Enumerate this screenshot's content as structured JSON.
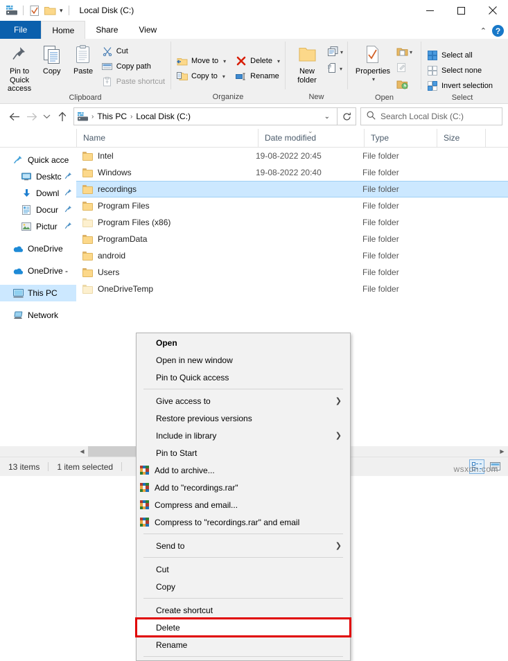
{
  "window": {
    "title": "Local Disk (C:)",
    "controls": {
      "minimize": "minimize-icon",
      "maximize": "maximize-icon",
      "close": "close-icon"
    }
  },
  "quick_access_toolbar": {
    "items": [
      "explorer-icon",
      "properties-icon",
      "new-folder-icon",
      "customize-caret"
    ]
  },
  "tabs": [
    {
      "label": "File",
      "id": "file"
    },
    {
      "label": "Home",
      "id": "home"
    },
    {
      "label": "Share",
      "id": "share"
    },
    {
      "label": "View",
      "id": "view"
    }
  ],
  "ribbon": {
    "groups": [
      {
        "label": "Clipboard",
        "big_buttons": [
          {
            "label": "Pin to Quick access",
            "icon": "pin-icon"
          },
          {
            "label": "Copy",
            "icon": "copy-icon"
          },
          {
            "label": "Paste",
            "icon": "paste-icon"
          }
        ],
        "small_buttons": [
          {
            "label": "Cut",
            "icon": "scissors-icon",
            "disabled": false
          },
          {
            "label": "Copy path",
            "icon": "copy-path-icon",
            "disabled": false
          },
          {
            "label": "Paste shortcut",
            "icon": "paste-shortcut-icon",
            "disabled": true
          }
        ]
      },
      {
        "label": "Organize",
        "small_buttons": [
          {
            "label": "Move to",
            "icon": "move-to-icon",
            "caret": true
          },
          {
            "label": "Copy to",
            "icon": "copy-to-icon",
            "caret": true
          },
          {
            "label": "Delete",
            "icon": "delete-x-icon",
            "caret": true
          },
          {
            "label": "Rename",
            "icon": "rename-icon",
            "caret": false
          }
        ]
      },
      {
        "label": "New",
        "big_buttons": [
          {
            "label": "New folder",
            "icon": "new-folder-icon"
          }
        ],
        "gallery": [
          "new-item-icon",
          "easy-access-icon"
        ]
      },
      {
        "label": "Open",
        "big_buttons": [
          {
            "label": "Properties",
            "icon": "properties-icon",
            "caret": true
          }
        ],
        "gallery": [
          "open-icon",
          "edit-icon",
          "history-icon"
        ]
      },
      {
        "label": "Select",
        "small_buttons": [
          {
            "label": "Select all",
            "icon": "select-all-icon"
          },
          {
            "label": "Select none",
            "icon": "select-none-icon"
          },
          {
            "label": "Invert selection",
            "icon": "invert-selection-icon"
          }
        ]
      }
    ]
  },
  "navigation": {
    "back": "back-arrow-icon",
    "forward": "forward-arrow-icon",
    "recent": "recent-locations-caret",
    "up": "up-arrow-icon",
    "breadcrumb": [
      "This PC",
      "Local Disk (C:)"
    ],
    "refresh": "refresh-icon",
    "search_placeholder": "Search Local Disk (C:)"
  },
  "columns": [
    {
      "label": "Name",
      "sorted": false
    },
    {
      "label": "Date modified",
      "sorted": true
    },
    {
      "label": "Type",
      "sorted": false
    },
    {
      "label": "Size",
      "sorted": false
    }
  ],
  "sidebar": {
    "items": [
      {
        "label": "Quick acce",
        "icon": "quick-access-star-icon",
        "indent": false,
        "pinned": false,
        "selected": false
      },
      {
        "label": "Desktc",
        "icon": "desktop-icon",
        "indent": true,
        "pinned": true,
        "selected": false
      },
      {
        "label": "Downl",
        "icon": "downloads-icon",
        "indent": true,
        "pinned": true,
        "selected": false
      },
      {
        "label": "Docur",
        "icon": "documents-icon",
        "indent": true,
        "pinned": true,
        "selected": false
      },
      {
        "label": "Pictur",
        "icon": "pictures-icon",
        "indent": true,
        "pinned": true,
        "selected": false
      },
      {
        "label": "OneDrive",
        "icon": "onedrive-icon",
        "indent": false,
        "pinned": false,
        "selected": false,
        "gap_before": true
      },
      {
        "label": "OneDrive -",
        "icon": "onedrive-icon",
        "indent": false,
        "pinned": false,
        "selected": false,
        "gap_before": true
      },
      {
        "label": "This PC",
        "icon": "this-pc-icon",
        "indent": false,
        "pinned": false,
        "selected": true,
        "gap_before": true
      },
      {
        "label": "Network",
        "icon": "network-icon",
        "indent": false,
        "pinned": false,
        "selected": false,
        "gap_before": true
      }
    ]
  },
  "files": [
    {
      "name": "Intel",
      "date": "19-08-2022 20:45",
      "type": "File folder",
      "size": "",
      "selected": false,
      "pale": false
    },
    {
      "name": "Windows",
      "date": "19-08-2022 20:40",
      "type": "File folder",
      "size": "",
      "selected": false,
      "pale": false
    },
    {
      "name": "recordings",
      "date": "",
      "type": "File folder",
      "size": "",
      "selected": true,
      "pale": false
    },
    {
      "name": "Program Files",
      "date": "",
      "type": "File folder",
      "size": "",
      "selected": false,
      "pale": false
    },
    {
      "name": "Program Files (x86)",
      "date": "",
      "type": "File folder",
      "size": "",
      "selected": false,
      "pale": true
    },
    {
      "name": "ProgramData",
      "date": "",
      "type": "File folder",
      "size": "",
      "selected": false,
      "pale": false
    },
    {
      "name": "android",
      "date": "",
      "type": "File folder",
      "size": "",
      "selected": false,
      "pale": false
    },
    {
      "name": "Users",
      "date": "",
      "type": "File folder",
      "size": "",
      "selected": false,
      "pale": false
    },
    {
      "name": "OneDriveTemp",
      "date": "",
      "type": "File folder",
      "size": "",
      "selected": false,
      "pale": true
    }
  ],
  "context_menu": {
    "items": [
      {
        "label": "Open",
        "bold": true,
        "icon": "",
        "arrow": false
      },
      {
        "label": "Open in new window",
        "bold": false,
        "icon": "",
        "arrow": false
      },
      {
        "label": "Pin to Quick access",
        "bold": false,
        "icon": "",
        "arrow": false
      },
      {
        "divider": true
      },
      {
        "label": "Give access to",
        "bold": false,
        "icon": "",
        "arrow": true
      },
      {
        "label": "Restore previous versions",
        "bold": false,
        "icon": "",
        "arrow": false
      },
      {
        "label": "Include in library",
        "bold": false,
        "icon": "",
        "arrow": true
      },
      {
        "label": "Pin to Start",
        "bold": false,
        "icon": "",
        "arrow": false
      },
      {
        "label": "Add to archive...",
        "bold": false,
        "icon": "winrar-icon",
        "arrow": false
      },
      {
        "label": "Add to \"recordings.rar\"",
        "bold": false,
        "icon": "winrar-icon",
        "arrow": false
      },
      {
        "label": "Compress and email...",
        "bold": false,
        "icon": "winrar-icon",
        "arrow": false
      },
      {
        "label": "Compress to \"recordings.rar\" and email",
        "bold": false,
        "icon": "winrar-icon",
        "arrow": false
      },
      {
        "divider": true
      },
      {
        "label": "Send to",
        "bold": false,
        "icon": "",
        "arrow": true
      },
      {
        "divider": true
      },
      {
        "label": "Cut",
        "bold": false,
        "icon": "",
        "arrow": false
      },
      {
        "label": "Copy",
        "bold": false,
        "icon": "",
        "arrow": false
      },
      {
        "divider": true
      },
      {
        "label": "Create shortcut",
        "bold": false,
        "icon": "",
        "arrow": false
      },
      {
        "label": "Delete",
        "bold": false,
        "icon": "",
        "arrow": false,
        "highlight": true
      },
      {
        "label": "Rename",
        "bold": false,
        "icon": "",
        "arrow": false
      },
      {
        "divider": true
      }
    ],
    "highlight_color": "#e00000"
  },
  "status_bar": {
    "item_count": "13 items",
    "selection": "1 item selected",
    "view_buttons": [
      "details-view-icon",
      "large-icons-view-icon"
    ]
  },
  "watermark": "wsxdn.com"
}
